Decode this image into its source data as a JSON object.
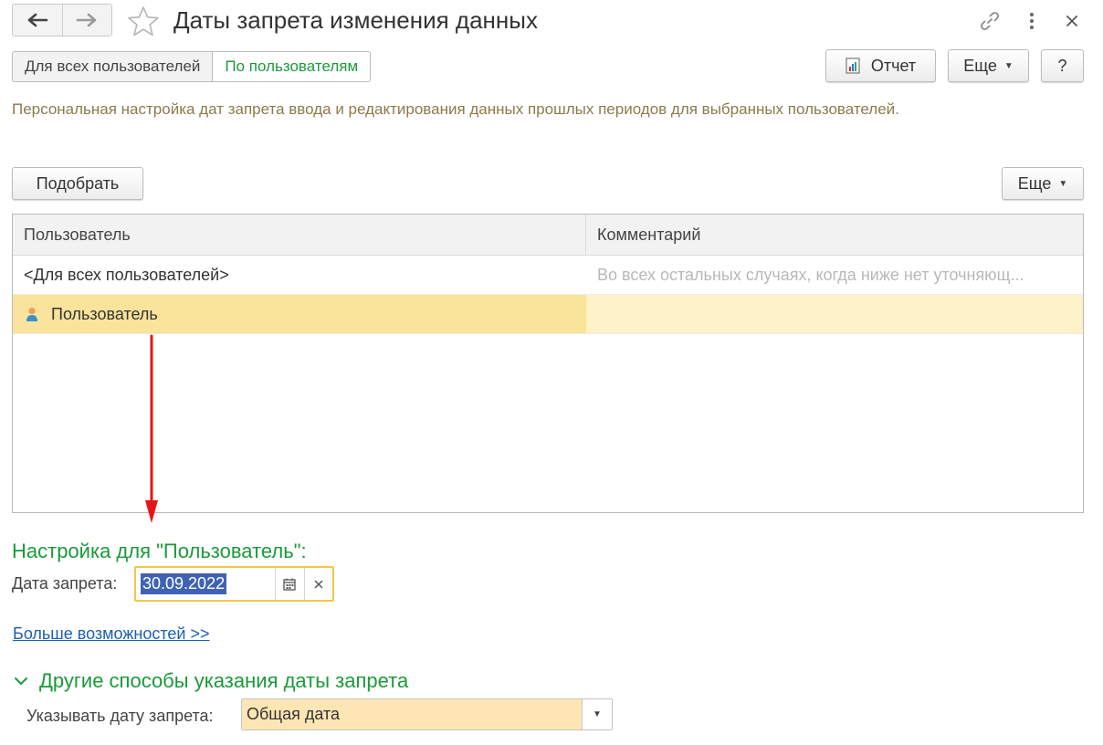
{
  "header": {
    "title": "Даты запрета изменения данных",
    "nav_back_icon": "arrow-left-icon",
    "nav_forward_icon": "arrow-right-icon",
    "favorite_icon": "star-icon",
    "link_icon": "link-icon",
    "more_icon": "kebab-icon",
    "close_icon": "close-icon"
  },
  "mode_toggle": {
    "all_users": "Для всех пользователей",
    "by_users": "По пользователям",
    "selected": "По пользователям"
  },
  "toolbar": {
    "report_label": "Отчет",
    "more_label": "Еще",
    "help_label": "?"
  },
  "description": "Персональная настройка дат запрета ввода и редактирования данных прошлых периодов для выбранных пользователей.",
  "list_toolbar": {
    "pick_label": "Подобрать",
    "more_label": "Еще"
  },
  "table": {
    "columns": [
      "Пользователь",
      "Комментарий"
    ],
    "rows": [
      {
        "user": "<Для всех пользователей>",
        "comment": "Во всех остальных случаях, когда ниже нет уточняющ..."
      },
      {
        "user": "Пользователь",
        "comment": "",
        "selected": true
      }
    ]
  },
  "settings": {
    "title": "Настройка для \"Пользователь\":",
    "date_label": "Дата запрета:",
    "date_value": "30.09.2022",
    "calendar_icon": "calendar-icon",
    "clear_icon": "clear-icon"
  },
  "more_options_link": "Больше возможностей >>",
  "other_methods": {
    "title": "Другие способы указания даты запрета",
    "specify_label": "Указывать дату запрета:",
    "specify_value": "Общая дата"
  },
  "colors": {
    "accent_green": "#1a9a3a",
    "selection_yellow": "#fae39a",
    "focus_border": "#f0c84a",
    "annotation_arrow": "#e8141a",
    "link_blue": "#1b5fb3"
  }
}
